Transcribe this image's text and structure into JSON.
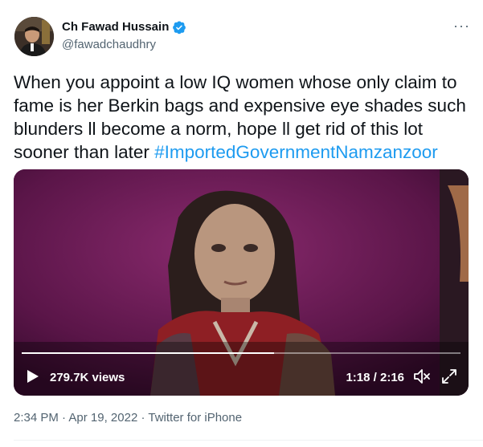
{
  "author": {
    "name": "Ch Fawad Hussain",
    "handle": "@fawadchaudhry",
    "verified": true
  },
  "tweet": {
    "text": "When you appoint a low IQ women whose only claim to fame is her Berkin bags and expensive eye shades such blunders ll become a norm, hope ll get rid of this lot sooner than later ",
    "hashtag": "#ImportedGovernmentNamzanzoor",
    "more_label": "···"
  },
  "video": {
    "views": "279.7K views",
    "timecode": "1:18 / 2:16",
    "progress_fraction": 0.575
  },
  "meta": {
    "time": "2:34 PM",
    "date": "Apr 19, 2022",
    "source": "Twitter for iPhone",
    "separator": " · "
  },
  "colors": {
    "accent": "#1d9bf0",
    "secondary_text": "#536471"
  }
}
